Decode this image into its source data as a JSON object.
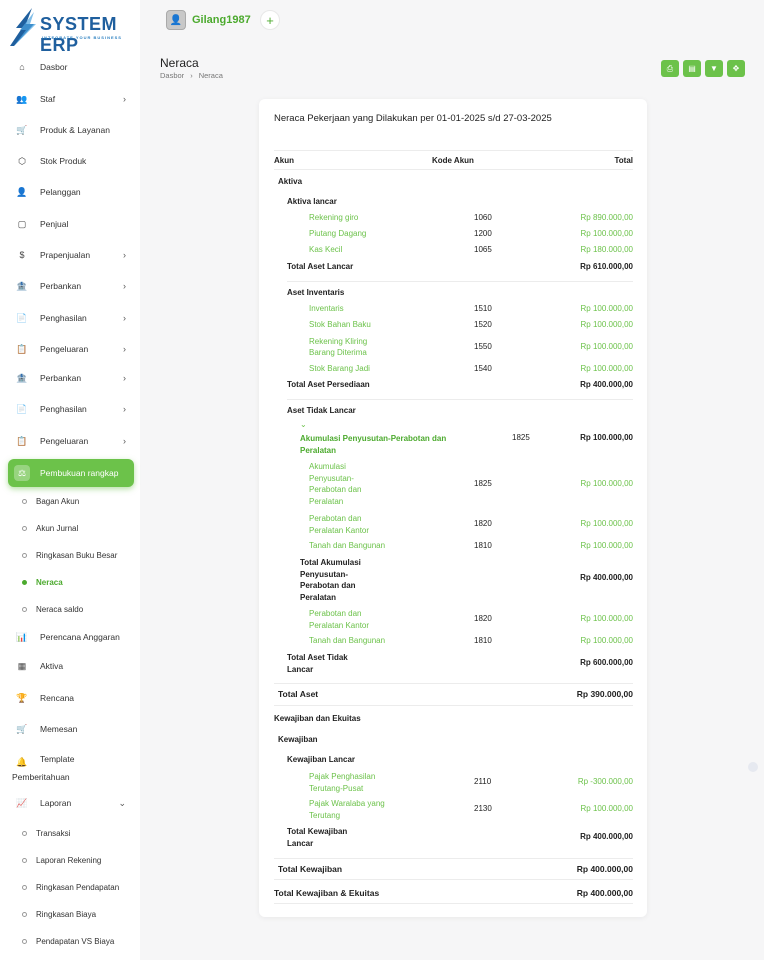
{
  "brand": {
    "name": "SYSTEM ERP",
    "tagline": "INTEGRATE YOUR BUSINESS"
  },
  "user": {
    "name": "Gilang1987"
  },
  "sidebar": {
    "items": [
      {
        "label": "Dasbor",
        "icon": "home-icon"
      },
      {
        "label": "Staf",
        "icon": "users-icon",
        "chevron": true
      },
      {
        "label": "Produk & Layanan",
        "icon": "cart-icon"
      },
      {
        "label": "Stok Produk",
        "icon": "box-icon"
      },
      {
        "label": "Pelanggan",
        "icon": "user-plus-icon"
      },
      {
        "label": "Penjual",
        "icon": "note-icon"
      },
      {
        "label": "Prapenjualan",
        "icon": "file-dollar-icon",
        "chevron": true
      },
      {
        "label": "Perbankan",
        "icon": "bank-icon",
        "chevron": true
      },
      {
        "label": "Penghasilan",
        "icon": "invoice-icon",
        "chevron": true
      },
      {
        "label": "Pengeluaran",
        "icon": "clipboard-icon",
        "chevron": true
      },
      {
        "label": "Perbankan",
        "icon": "bank-icon",
        "chevron": true
      },
      {
        "label": "Penghasilan",
        "icon": "invoice-icon",
        "chevron": true
      },
      {
        "label": "Pengeluaran",
        "icon": "clipboard-icon",
        "chevron": true
      },
      {
        "label": "Pembukuan rangkap",
        "icon": "scale-icon",
        "active": true
      },
      {
        "label": "Perencana Anggaran",
        "icon": "chart-icon"
      },
      {
        "label": "Aktiva",
        "icon": "calculator-icon"
      },
      {
        "label": "Rencana",
        "icon": "trophy-icon"
      },
      {
        "label": "Memesan",
        "icon": "cart-icon"
      },
      {
        "label": "Template",
        "label2": "Pemberitahuan",
        "icon": "bell-icon"
      },
      {
        "label": "Laporan",
        "icon": "trend-icon",
        "chevron_down": true
      }
    ],
    "sub_pembukuan": [
      "Bagan Akun",
      "Akun Jurnal",
      "Ringkasan Buku Besar",
      "Neraca",
      "Neraca saldo"
    ],
    "sub_laporan": [
      "Transaksi",
      "Laporan Rekening",
      "Ringkasan Pendapatan",
      "Ringkasan Biaya",
      "Pendapatan VS Biaya"
    ]
  },
  "page": {
    "title": "Neraca",
    "breadcrumb": [
      "Dasbor",
      "Neraca"
    ]
  },
  "tools": [
    "print-icon",
    "file-icon",
    "filter-icon",
    "expand-icon"
  ],
  "report": {
    "title": "Neraca Pekerjaan yang Dilakukan per 01-01-2025 s/d 27-03-2025",
    "columns": {
      "account": "Akun",
      "code": "Kode Akun",
      "total": "Total"
    },
    "aktiva": "Aktiva",
    "aktiva_lancar": "Aktiva lancar",
    "lancar_rows": [
      {
        "name": "Rekening giro",
        "code": "1060",
        "total": "Rp 890.000,00"
      },
      {
        "name": "Piutang Dagang",
        "code": "1200",
        "total": "Rp 100.000,00"
      },
      {
        "name": "Kas Kecil",
        "code": "1065",
        "total": "Rp 180.000,00"
      }
    ],
    "total_aset_lancar": {
      "label": "Total Aset Lancar",
      "total": "Rp 610.000,00"
    },
    "aset_inventaris": "Aset Inventaris",
    "inventaris_rows": [
      {
        "name": "Inventaris",
        "code": "1510",
        "total": "Rp 100.000,00"
      },
      {
        "name": "Stok Bahan Baku",
        "code": "1520",
        "total": "Rp 100.000,00"
      },
      {
        "name": "Rekening Kliring",
        "name2": "Barang Diterima",
        "code": "1550",
        "total": "Rp 100.000,00"
      },
      {
        "name": "Stok Barang Jadi",
        "code": "1540",
        "total": "Rp 100.000,00"
      }
    ],
    "total_aset_persediaan": {
      "label": "Total Aset Persediaan",
      "total": "Rp 400.000,00"
    },
    "aset_tidak_lancar": "Aset Tidak Lancar",
    "akumulasi": {
      "name": "Akumulasi Penyusutan-Perabotan dan",
      "name2": "Peralatan",
      "code": "1825",
      "total": "Rp 100.000,00"
    },
    "akumulasi_rows": [
      {
        "lines": [
          "Akumulasi",
          "Penyusutan-",
          "Perabotan dan",
          "Peralatan"
        ],
        "code": "1825",
        "total": "Rp 100.000,00"
      },
      {
        "lines": [
          "Perabotan dan",
          "Peralatan Kantor"
        ],
        "code": "1820",
        "total": "Rp 100.000,00"
      },
      {
        "lines": [
          "Tanah dan Bangunan"
        ],
        "code": "1810",
        "total": "Rp 100.000,00"
      }
    ],
    "total_akumulasi": {
      "lines": [
        "Total Akumulasi",
        "Penyusutan-",
        "Perabotan dan",
        "Peralatan"
      ],
      "total": "Rp 400.000,00"
    },
    "tidak_lancar_rows": [
      {
        "lines": [
          "Perabotan dan",
          "Peralatan Kantor"
        ],
        "code": "1820",
        "total": "Rp 100.000,00"
      },
      {
        "lines": [
          "Tanah dan Bangunan"
        ],
        "code": "1810",
        "total": "Rp 100.000,00"
      }
    ],
    "total_aset_tidak_lancar": {
      "lines": [
        "Total Aset Tidak",
        "Lancar"
      ],
      "total": "Rp 600.000,00"
    },
    "total_aset": {
      "label": "Total Aset",
      "total": "Rp 390.000,00"
    },
    "kewajiban_ekuitas": "Kewajiban dan Ekuitas",
    "kewajiban": "Kewajiban",
    "kewajiban_lancar": "Kewajiban Lancar",
    "kewajiban_rows": [
      {
        "lines": [
          "Pajak Penghasilan",
          "Terutang-Pusat"
        ],
        "code": "2110",
        "total": "Rp -300.000,00"
      },
      {
        "lines": [
          "Pajak Waralaba yang",
          "Terutang"
        ],
        "code": "2130",
        "total": "Rp 100.000,00"
      }
    ],
    "total_kewajiban_lancar": {
      "lines": [
        "Total Kewajiban",
        "Lancar"
      ],
      "total": "Rp 400.000,00"
    },
    "total_kewajiban": {
      "label": "Total Kewajiban",
      "total": "Rp 400.000,00"
    },
    "total_kewajiban_ekuitas": {
      "label": "Total Kewajiban & Ekuitas",
      "total": "Rp 400.000,00"
    }
  }
}
